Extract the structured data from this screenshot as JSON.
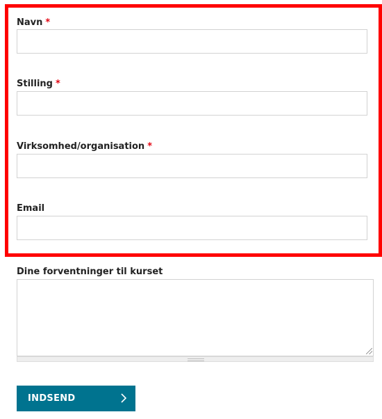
{
  "form": {
    "fields": [
      {
        "label": "Navn",
        "required_mark": "*",
        "value": ""
      },
      {
        "label": "Stilling",
        "required_mark": "*",
        "value": ""
      },
      {
        "label": "Virksomhed/organisation",
        "required_mark": "*",
        "value": ""
      },
      {
        "label": "Email",
        "value": ""
      }
    ],
    "expectations": {
      "label": "Dine forventninger til kurset",
      "value": ""
    },
    "submit_label": "INDSEND"
  },
  "colors": {
    "highlight_border": "#ff0000",
    "required_mark": "#e30613",
    "submit_background": "#00738f"
  },
  "icons": {
    "submit_icon": "chevron-right-icon",
    "textarea_resize": "resize-handle-icon"
  }
}
